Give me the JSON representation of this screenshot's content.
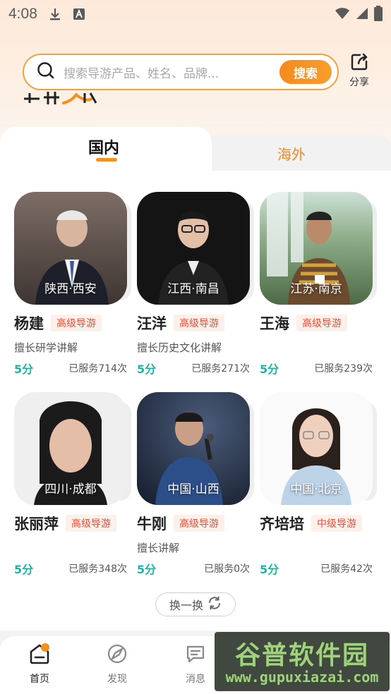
{
  "status_bar": {
    "time": "4:08"
  },
  "search": {
    "placeholder": "搜索导游产品、姓名、品牌...",
    "button": "搜索"
  },
  "share": {
    "label": "分享"
  },
  "tabs": [
    {
      "label": "国内",
      "active": true
    },
    {
      "label": "海外",
      "active": false
    }
  ],
  "guides": [
    {
      "location": "陕西·西安",
      "name": "杨建",
      "level": "高级导游",
      "skill": "擅长研学讲解",
      "rating": "5分",
      "served": "已服务714次"
    },
    {
      "location": "江西·南昌",
      "name": "汪洋",
      "level": "高级导游",
      "skill": "擅长历史文化讲解",
      "rating": "5分",
      "served": "已服务271次"
    },
    {
      "location": "江苏·南京",
      "name": "王海",
      "level": "高级导游",
      "skill": "",
      "rating": "5分",
      "served": "已服务239次"
    },
    {
      "location": "四川·成都",
      "name": "张丽萍",
      "level": "高级导游",
      "skill": "",
      "rating": "5分",
      "served": "已服务348次"
    },
    {
      "location": "中国·山西",
      "name": "牛刚",
      "level": "高级导游",
      "skill": "擅长讲解",
      "rating": "5分",
      "served": "已服务0次"
    },
    {
      "location": "中国·北京",
      "name": "齐培培",
      "level": "中级导游",
      "skill": "",
      "rating": "5分",
      "served": "已服务42次"
    }
  ],
  "refresh": {
    "label": "换一换"
  },
  "bottom_nav": [
    {
      "label": "首页",
      "icon": "home-icon",
      "active": true
    },
    {
      "label": "发现",
      "icon": "discover-icon",
      "active": false
    },
    {
      "label": "消息",
      "icon": "message-icon",
      "active": false
    }
  ],
  "watermark": {
    "title": "谷普软件园",
    "url": "www.gupuxiazai.com"
  },
  "colors": {
    "accent": "#f5901f",
    "rating": "#19b6a2",
    "level_text": "#e8503a"
  }
}
